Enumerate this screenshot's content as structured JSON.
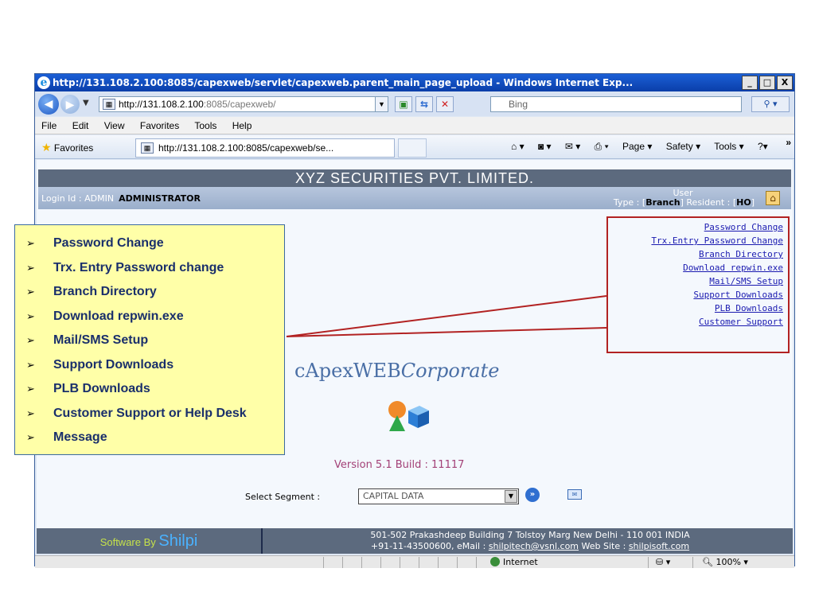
{
  "window": {
    "title": "http://131.108.2.100:8085/capexweb/servlet/capexweb.parent_main_page_upload - Windows Internet Exp...",
    "address": "http://131.108.2.100:8085/capexweb/",
    "address_host": "http://131.108.2.100",
    "address_rest": ":8085/capexweb/",
    "search_placeholder": "Bing",
    "tab_title": "http://131.108.2.100:8085/capexweb/se...",
    "min_label": "_",
    "max_label": "□",
    "close_label": "X"
  },
  "menubar": [
    "File",
    "Edit",
    "View",
    "Favorites",
    "Tools",
    "Help"
  ],
  "favbar": {
    "favorites": "Favorites",
    "page": "Page ▾",
    "safety": "Safety ▾",
    "tools": "Tools ▾",
    "help": "?▾",
    "chevron": "»"
  },
  "page": {
    "banner": "XYZ SECURITIES PVT. LIMITED.",
    "login_label": "Login Id : ADMIN",
    "login_name": "ADMINISTRATOR",
    "user_label": "User",
    "type_label": "Type : [",
    "type_value": "Branch",
    "resident_label": "]  Resident : [",
    "resident_value": "HO",
    "resident_close": "]",
    "links": [
      "Password Change",
      "Trx.Entry Password Change",
      "Branch Directory",
      "Download repwin.exe",
      "Mail/SMS Setup",
      "Support Downloads",
      "PLB Downloads",
      "Customer Support"
    ],
    "brand_main": "cApexWEB",
    "brand_italic": "Corporate",
    "version": "Version 5.1 Build : 11117",
    "segment_label": "Select Segment :",
    "segment_value": "CAPITAL DATA"
  },
  "footer": {
    "software_by": "Software By ",
    "shilpi": "Shilpi",
    "address_line1": "501-502 Prakashdeep Building 7 Tolstoy Marg New Delhi - 110 001 INDIA",
    "address_line2_prefix": "+91-11-43500600, eMail : ",
    "email": "shilpitech@vsnl.com",
    "website_label": " Web Site : ",
    "website": "shilpisoft.com"
  },
  "statusbar": {
    "zone": "Internet",
    "zoom": "100%"
  },
  "callout": {
    "items": [
      "Password Change",
      "Trx. Entry Password change",
      "Branch Directory",
      "Download repwin.exe",
      "Mail/SMS Setup",
      "Support Downloads",
      "PLB Downloads",
      "Customer Support or Help Desk",
      "Message"
    ]
  },
  "colors": {
    "titlebar": "#0a3ea9",
    "callout_bg": "#ffffa8",
    "callout_text": "#1a2f6b",
    "highlight_border": "#b22222",
    "link": "#1a1ab0"
  }
}
